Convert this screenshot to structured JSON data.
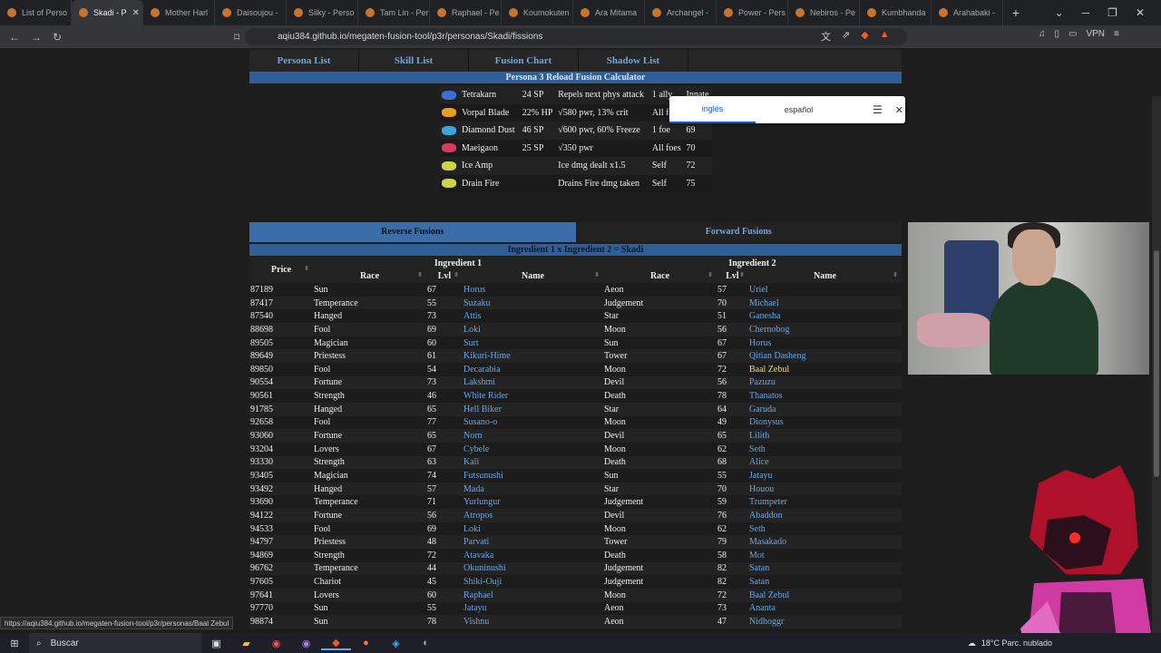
{
  "tabs": [
    {
      "label": "List of Perso",
      "active": false
    },
    {
      "label": "Skadi - P",
      "active": true
    },
    {
      "label": "Mother Harl",
      "active": false
    },
    {
      "label": "Daisoujou -",
      "active": false
    },
    {
      "label": "Silky - Perso",
      "active": false
    },
    {
      "label": "Tam Lin - Per",
      "active": false
    },
    {
      "label": "Raphael - Pe",
      "active": false
    },
    {
      "label": "Koumokuten",
      "active": false
    },
    {
      "label": "Ara Mitama",
      "active": false
    },
    {
      "label": "Archangel -",
      "active": false
    },
    {
      "label": "Power - Pers",
      "active": false
    },
    {
      "label": "Nebiros - Pe",
      "active": false
    },
    {
      "label": "Kumbhanda",
      "active": false
    },
    {
      "label": "Arahabaki -",
      "active": false
    }
  ],
  "browser": {
    "url": "aqiu384.github.io/megaten-fusion-tool/p3r/personas/Skadi/fissions",
    "vpn": "VPN"
  },
  "nav": [
    "Persona List",
    "Skill List",
    "Fusion Chart",
    "Shadow List"
  ],
  "calc_title": "Persona 3 Reload Fusion Calculator",
  "translate": {
    "lang1": "inglés",
    "lang2": "español"
  },
  "skills": [
    {
      "name": "Tetrakarn",
      "cost": "24 SP",
      "effect": "Repels next phys attack",
      "target": "1 ally",
      "level": "Innate",
      "color": "#3a6fd6"
    },
    {
      "name": "Vorpal Blade",
      "cost": "22% HP",
      "effect": "√580 pwr, 13% crit",
      "target": "All foes",
      "level": "Innate",
      "color": "#e8a21a"
    },
    {
      "name": "Diamond Dust",
      "cost": "46 SP",
      "effect": "√600 pwr, 60% Freeze",
      "target": "1 foe",
      "level": "69",
      "color": "#35a8e0"
    },
    {
      "name": "Maeigaon",
      "cost": "25 SP",
      "effect": "√350 pwr",
      "target": "All foes",
      "level": "70",
      "color": "#d93b5f"
    },
    {
      "name": "Ice Amp",
      "cost": "",
      "effect": "Ice dmg dealt x1.5",
      "target": "Self",
      "level": "72",
      "color": "#c9d64a"
    },
    {
      "name": "Drain Fire",
      "cost": "",
      "effect": "Drains Fire dmg taken",
      "target": "Self",
      "level": "75",
      "color": "#c9d64a"
    }
  ],
  "fusion_tabs": {
    "reverse": "Reverse Fusions",
    "forward": "Forward Fusions"
  },
  "fusion_title": "Ingredient 1 x Ingredient 2 = Skadi",
  "headers": {
    "price": "Price",
    "ing1": "Ingredient 1",
    "ing2": "Ingredient 2",
    "race": "Race",
    "lvl": "Lvl",
    "name": "Name"
  },
  "rows": [
    [
      "87189",
      "Sun",
      "67",
      "Horus",
      "Aeon",
      "57",
      "Uriel"
    ],
    [
      "87417",
      "Temperance",
      "55",
      "Suzaku",
      "Judgement",
      "70",
      "Michael"
    ],
    [
      "87540",
      "Hanged",
      "73",
      "Attis",
      "Star",
      "51",
      "Ganesha"
    ],
    [
      "88698",
      "Fool",
      "69",
      "Loki",
      "Moon",
      "56",
      "Chernobog"
    ],
    [
      "89505",
      "Magician",
      "60",
      "Surt",
      "Sun",
      "67",
      "Horus"
    ],
    [
      "89649",
      "Priestess",
      "61",
      "Kikuri-Hime",
      "Tower",
      "67",
      "Qitian Dasheng"
    ],
    [
      "89850",
      "Fool",
      "54",
      "Decarabia",
      "Moon",
      "72",
      "Baal Zebul"
    ],
    [
      "90554",
      "Fortune",
      "73",
      "Lakshmi",
      "Devil",
      "56",
      "Pazuzu"
    ],
    [
      "90561",
      "Strength",
      "46",
      "White Rider",
      "Death",
      "78",
      "Thanatos"
    ],
    [
      "91785",
      "Hanged",
      "65",
      "Hell Biker",
      "Star",
      "64",
      "Garuda"
    ],
    [
      "92658",
      "Fool",
      "77",
      "Susano-o",
      "Moon",
      "49",
      "Dionysus"
    ],
    [
      "93060",
      "Fortune",
      "65",
      "Norn",
      "Devil",
      "65",
      "Lilith"
    ],
    [
      "93204",
      "Lovers",
      "67",
      "Cybele",
      "Moon",
      "62",
      "Seth"
    ],
    [
      "93330",
      "Strength",
      "63",
      "Kali",
      "Death",
      "68",
      "Alice"
    ],
    [
      "93405",
      "Magician",
      "74",
      "Futsunushi",
      "Sun",
      "55",
      "Jatayu"
    ],
    [
      "93492",
      "Hanged",
      "57",
      "Mada",
      "Star",
      "70",
      "Houou"
    ],
    [
      "93690",
      "Temperance",
      "71",
      "Yurlungur",
      "Judgement",
      "59",
      "Trumpeter"
    ],
    [
      "94122",
      "Fortune",
      "56",
      "Atropos",
      "Devil",
      "76",
      "Abaddon"
    ],
    [
      "94533",
      "Fool",
      "69",
      "Loki",
      "Moon",
      "62",
      "Seth"
    ],
    [
      "94797",
      "Priestess",
      "48",
      "Parvati",
      "Tower",
      "79",
      "Masakado"
    ],
    [
      "94869",
      "Strength",
      "72",
      "Atavaka",
      "Death",
      "58",
      "Mot"
    ],
    [
      "96762",
      "Temperance",
      "44",
      "Okuninushi",
      "Judgement",
      "82",
      "Satan"
    ],
    [
      "97605",
      "Chariot",
      "45",
      "Shiki-Ouji",
      "Judgement",
      "82",
      "Satan"
    ],
    [
      "97641",
      "Lovers",
      "60",
      "Raphael",
      "Moon",
      "72",
      "Baal Zebul"
    ],
    [
      "97770",
      "Sun",
      "55",
      "Jatayu",
      "Aeon",
      "73",
      "Ananta"
    ],
    [
      "98874",
      "Sun",
      "78",
      "Vishnu",
      "Aeon",
      "47",
      "Nidhoggr"
    ]
  ],
  "highlight_row": 6,
  "status_url": "https://aqiu384.github.io/megaten-fusion-tool/p3r/personas/Baal Zebul",
  "taskbar": {
    "search": "Buscar",
    "weather": "18°C  Parc. nublado"
  }
}
